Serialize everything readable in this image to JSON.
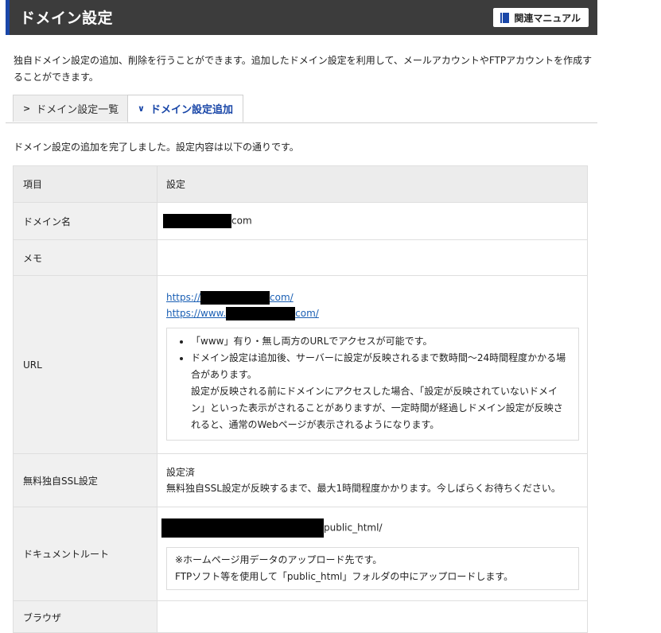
{
  "header": {
    "title": "ドメイン設定",
    "manual_button": "関連マニュアル"
  },
  "description": "独自ドメイン設定の追加、削除を行うことができます。追加したドメイン設定を利用して、メールアカウントやFTPアカウントを作成することができます。",
  "tabs": [
    {
      "label": "ドメイン設定一覧",
      "active": false
    },
    {
      "label": "ドメイン設定追加",
      "active": true
    }
  ],
  "complete_message": "ドメイン設定の追加を完了しました。設定内容は以下の通りです。",
  "table": {
    "header": {
      "item": "項目",
      "setting": "設定"
    },
    "domain": {
      "label": "ドメイン名",
      "suffix": "com"
    },
    "memo": {
      "label": "メモ",
      "value": ""
    },
    "url": {
      "label": "URL",
      "link1_prefix": "https://",
      "link1_suffix": "com/",
      "link2_prefix": "https://www.",
      "link2_suffix": "com/",
      "note1": "「www」有り・無し両方のURLでアクセスが可能です。",
      "note2": "ドメイン設定は追加後、サーバーに設定が反映されるまで数時間〜24時間程度かかる場合があります。",
      "note3": "設定が反映される前にドメインにアクセスした場合、「設定が反映されていないドメイン」といった表示がされることがありますが、一定時間が経過しドメイン設定が反映されると、通常のWebページが表示されるようになります。"
    },
    "ssl": {
      "label": "無料独自SSL設定",
      "status": "設定済",
      "note": "無料独自SSL設定が反映するまで、最大1時間程度かかります。今しばらくお待ちください。"
    },
    "docroot": {
      "label": "ドキュメントルート",
      "suffix": "public_html/",
      "note1": "※ホームページ用データのアップロード先です。",
      "note2": "FTPソフト等を使用して「public_html」フォルダの中にアップロードします。"
    },
    "next_label": "ブラウザ"
  },
  "colors": {
    "header_bg": "#3c3c3c",
    "accent": "#1a47a8",
    "link": "#1a5fb4"
  }
}
